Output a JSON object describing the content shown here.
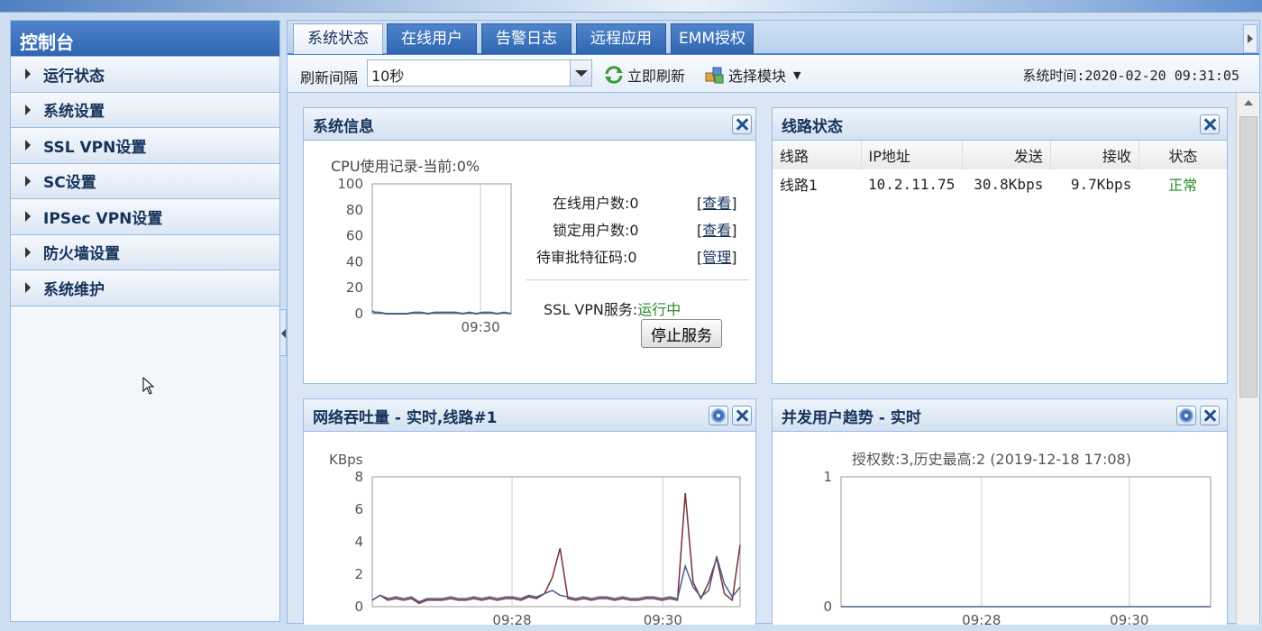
{
  "sidebar": {
    "title": "控制台",
    "items": [
      {
        "label": "运行状态"
      },
      {
        "label": "系统设置"
      },
      {
        "label": "SSL VPN设置"
      },
      {
        "label": "SC设置"
      },
      {
        "label": "IPSec VPN设置"
      },
      {
        "label": "防火墙设置"
      },
      {
        "label": "系统维护"
      }
    ]
  },
  "tabs": [
    {
      "label": "系统状态",
      "active": true
    },
    {
      "label": "在线用户"
    },
    {
      "label": "告警日志"
    },
    {
      "label": "远程应用"
    },
    {
      "label": "EMM授权"
    }
  ],
  "toolbar": {
    "refresh_interval_label": "刷新间隔",
    "refresh_interval_value": "10秒",
    "refresh_now": "立即刷新",
    "select_module": "选择模块",
    "system_time_label": "系统时间:",
    "system_time": "2020-02-20 09:31:05"
  },
  "system_info": {
    "title": "系统信息",
    "cpu_caption": "CPU使用记录-当前:0%",
    "online_users_label": "在线用户数:0",
    "online_users_action": "查看",
    "locked_users_label": "锁定用户数:0",
    "locked_users_action": "查看",
    "pending_label": "待审批特征码:0",
    "pending_action": "管理",
    "ssl_service_label": "SSL VPN服务:",
    "ssl_service_status": "运行中",
    "stop_button": "停止服务"
  },
  "line_status": {
    "title": "线路状态",
    "columns": [
      "线路",
      "IP地址",
      "发送",
      "接收",
      "状态"
    ],
    "rows": [
      {
        "line": "线路1",
        "ip": "10.2.11.75",
        "send": "30.8Kbps",
        "recv": "9.7Kbps",
        "status": "正常"
      }
    ],
    "status_color": "#2b8a2b"
  },
  "throughput": {
    "title": "网络吞吐量 - 实时,线路#1"
  },
  "concurrent": {
    "title": "并发用户趋势 - 实时",
    "caption": "授权数:3,历史最高:2 (2019-12-18 17:08)"
  },
  "colors": {
    "accent": "#2f66b1",
    "border": "#99bbe8",
    "series_send": "#7a2e3a",
    "series_recv": "#4a5f88"
  },
  "chart_data": [
    {
      "type": "line",
      "title": "CPU使用记录-当前:0%",
      "ylim": [
        0,
        100
      ],
      "yticks": [
        0,
        20,
        40,
        60,
        80,
        100
      ],
      "xticks": [
        "09:30"
      ],
      "series": [
        {
          "x": [
            0,
            0.02,
            0.05,
            0.1,
            0.15,
            0.2,
            0.25,
            0.3,
            0.35,
            0.4,
            0.45,
            0.5,
            0.55,
            0.6,
            0.65,
            0.7,
            0.75,
            0.8,
            0.85,
            0.9,
            0.95,
            1
          ],
          "values": [
            2,
            1,
            1,
            0,
            0,
            0,
            0,
            1,
            1,
            0,
            1,
            1,
            1,
            1,
            0,
            1,
            0,
            1,
            1,
            0,
            1,
            0
          ]
        }
      ]
    },
    {
      "type": "line",
      "title": "网络吞吐量 - 实时,线路#1",
      "ylabel": "KBps",
      "ylim": [
        0,
        8
      ],
      "yticks": [
        0,
        2,
        4,
        6,
        8
      ],
      "xticks": [
        "09:28",
        "09:30"
      ],
      "series": [
        {
          "color": "#7a2e3a",
          "values": [
            0.4,
            0.7,
            0.4,
            0.5,
            0.4,
            0.5,
            0.2,
            0.4,
            0.4,
            0.4,
            0.5,
            0.4,
            0.4,
            0.5,
            0.4,
            0.5,
            0.4,
            0.5,
            0.5,
            0.4,
            0.6,
            0.5,
            0.8,
            1.8,
            3.6,
            0.5,
            0.4,
            0.5,
            0.4,
            0.5,
            0.5,
            0.4,
            0.5,
            0.4,
            0.4,
            0.5,
            0.5,
            0.4,
            0.5,
            0.4,
            7.0,
            1.5,
            0.5,
            1.5,
            3.0,
            0.8,
            0.4,
            3.8
          ]
        },
        {
          "color": "#4a5f88",
          "values": [
            0.4,
            0.7,
            0.5,
            0.6,
            0.5,
            0.6,
            0.3,
            0.5,
            0.5,
            0.5,
            0.6,
            0.5,
            0.5,
            0.6,
            0.5,
            0.6,
            0.5,
            0.6,
            0.6,
            0.5,
            0.7,
            0.6,
            0.8,
            1.0,
            0.7,
            0.6,
            0.5,
            0.6,
            0.5,
            0.6,
            0.6,
            0.5,
            0.6,
            0.5,
            0.5,
            0.6,
            0.6,
            0.5,
            0.6,
            0.5,
            2.5,
            1.2,
            0.6,
            1.0,
            3.1,
            1.4,
            0.6,
            1.2
          ]
        }
      ]
    },
    {
      "type": "line",
      "title": "授权数:3,历史最高:2 (2019-12-18 17:08)",
      "ylim": [
        0,
        1
      ],
      "yticks": [
        0,
        1
      ],
      "xticks": [
        "09:28",
        "09:30"
      ],
      "series": [
        {
          "values": [
            0,
            0,
            0,
            0,
            0,
            0,
            0,
            0,
            0,
            0
          ]
        }
      ]
    }
  ]
}
